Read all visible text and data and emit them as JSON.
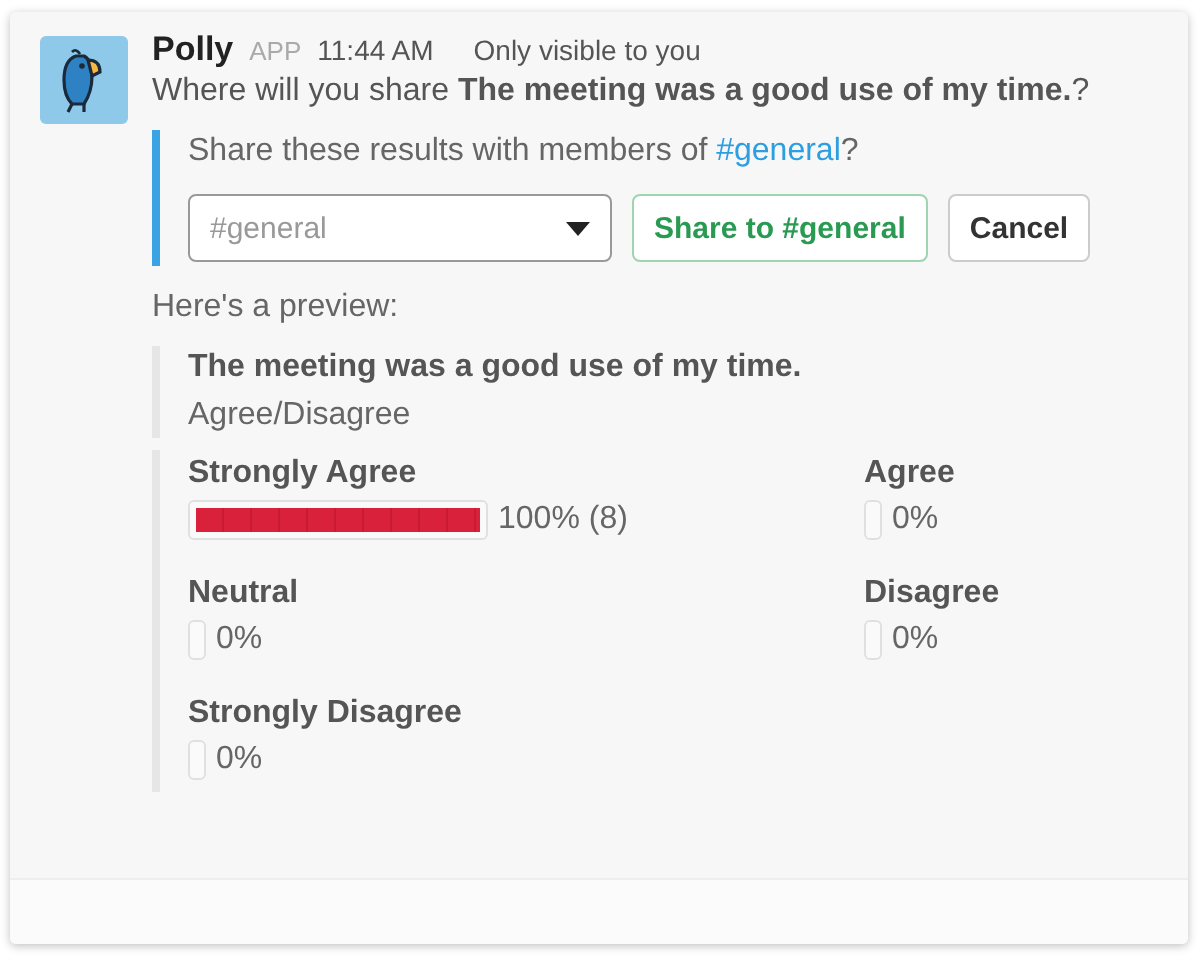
{
  "message": {
    "sender": "Polly",
    "badge": "APP",
    "time": "11:44 AM",
    "visibility": "Only visible to you",
    "text": "Where will you share **The meeting was a good use of my time.**?"
  },
  "share_prompt": {
    "before": "Share these results with members of ",
    "channel": "#general",
    "after": "?"
  },
  "channel_select": {
    "placeholder": "#general"
  },
  "buttons": [
    {
      "label": "Share to #general",
      "kind": "primary"
    },
    {
      "label": "Cancel",
      "kind": "secondary"
    }
  ],
  "preview_label": "Here's a preview:",
  "poll": {
    "question": "The meeting was a good use of my time.",
    "type": "Agree/Disagree"
  },
  "results": [
    {
      "label": "Strongly Agree",
      "reading": "100% (8)"
    },
    {
      "label": "Agree",
      "reading": "0%"
    },
    {
      "label": "Neutral",
      "reading": "0%"
    },
    {
      "label": "Disagree",
      "reading": "0%"
    },
    {
      "label": "Strongly Disagree",
      "reading": "0%"
    }
  ]
}
